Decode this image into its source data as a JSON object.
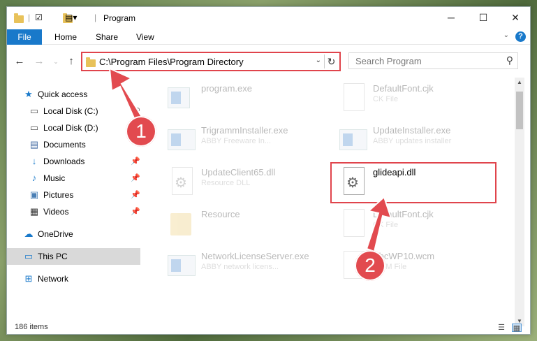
{
  "titlebar": {
    "title": "Program",
    "minimize_icon": "minimize-icon",
    "maximize_icon": "maximize-icon",
    "close_icon": "close-icon"
  },
  "ribbon": {
    "file": "File",
    "home": "Home",
    "share": "Share",
    "view": "View"
  },
  "address": {
    "path": "C:\\Program Files\\Program Directory"
  },
  "search": {
    "placeholder": "Search Program"
  },
  "sidebar": {
    "items": [
      {
        "label": "Quick access",
        "icon": "star-icon"
      },
      {
        "label": "Local Disk (C:)",
        "icon": "drive-icon"
      },
      {
        "label": "Local Disk (D:)",
        "icon": "drive-icon"
      },
      {
        "label": "Documents",
        "icon": "documents-icon"
      },
      {
        "label": "Downloads",
        "icon": "download-icon"
      },
      {
        "label": "Music",
        "icon": "music-icon"
      },
      {
        "label": "Pictures",
        "icon": "pictures-icon"
      },
      {
        "label": "Videos",
        "icon": "videos-icon"
      },
      {
        "label": "OneDrive",
        "icon": "cloud-icon"
      },
      {
        "label": "This PC",
        "icon": "computer-icon"
      },
      {
        "label": "Network",
        "icon": "network-icon"
      }
    ]
  },
  "files": [
    {
      "name": "program.exe",
      "sub": ""
    },
    {
      "name": "DefaultFont.cjk",
      "sub": "CK File"
    },
    {
      "name": "TrigrammInstaller.exe",
      "sub": "ABBY Freeware In..."
    },
    {
      "name": "UpdateInstaller.exe",
      "sub": "ABBY updates installer"
    },
    {
      "name": "UpdateClient65.dll",
      "sub": "Resource DLL"
    },
    {
      "name": "glideapi.dll",
      "sub": ""
    },
    {
      "name": "Resource",
      "sub": ""
    },
    {
      "name": "DefaultFont.cjk",
      "sub": "CK File"
    },
    {
      "name": "NetworkLicenseServer.exe",
      "sub": "ABBY network licens..."
    },
    {
      "name": "AbcWP10.wcm",
      "sub": "WCM File"
    }
  ],
  "status": {
    "count": "186 items"
  },
  "callouts": {
    "one": "1",
    "two": "2"
  },
  "colors": {
    "highlight": "#e0444c",
    "accent": "#1979ca"
  }
}
